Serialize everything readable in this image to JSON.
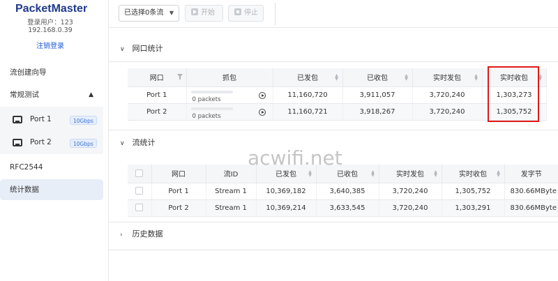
{
  "app": {
    "brand": "PacketMaster",
    "login_user": "登录用户：123",
    "ip": "192.168.0.39",
    "logout": "注销登录"
  },
  "sidebar": {
    "flow_wizard": "流创建向导",
    "regular_test": "常规测试",
    "ports": [
      {
        "label": "Port 1",
        "speed": "10Gbps"
      },
      {
        "label": "Port 2",
        "speed": "10Gbps"
      }
    ],
    "rfc": "RFC2544",
    "stats": "统计数据"
  },
  "toolbar": {
    "select_label": "已选择0条流",
    "start_label": "开始",
    "stop_label": "停止"
  },
  "port_stats": {
    "title": "网口统计",
    "columns": [
      "网口",
      "抓包",
      "已发包",
      "已收包",
      "实时发包",
      "实时收包"
    ],
    "rows": [
      {
        "port": "Port 1",
        "capture": "0 packets",
        "sent": "11,160,720",
        "recv": "3,911,057",
        "rt_sent": "3,720,240",
        "rt_recv": "1,303,273"
      },
      {
        "port": "Port 2",
        "capture": "0 packets",
        "sent": "11,160,721",
        "recv": "3,918,267",
        "rt_sent": "3,720,240",
        "rt_recv": "1,305,752"
      }
    ]
  },
  "flow_stats": {
    "title": "流统计",
    "columns": [
      "网口",
      "流ID",
      "已发包",
      "已收包",
      "实时发包",
      "实时收包",
      "发字节"
    ],
    "rows": [
      {
        "port": "Port 1",
        "stream": "Stream 1",
        "sent": "10,369,182",
        "recv": "3,640,385",
        "rt_sent": "3,720,240",
        "rt_recv": "1,305,752",
        "bytes": "830.66MByte"
      },
      {
        "port": "Port 2",
        "stream": "Stream 1",
        "sent": "10,369,214",
        "recv": "3,633,545",
        "rt_sent": "3,720,240",
        "rt_recv": "1,303,291",
        "bytes": "830.66MByte"
      }
    ]
  },
  "history": {
    "title": "历史数据"
  },
  "watermark": "acwifi.net"
}
